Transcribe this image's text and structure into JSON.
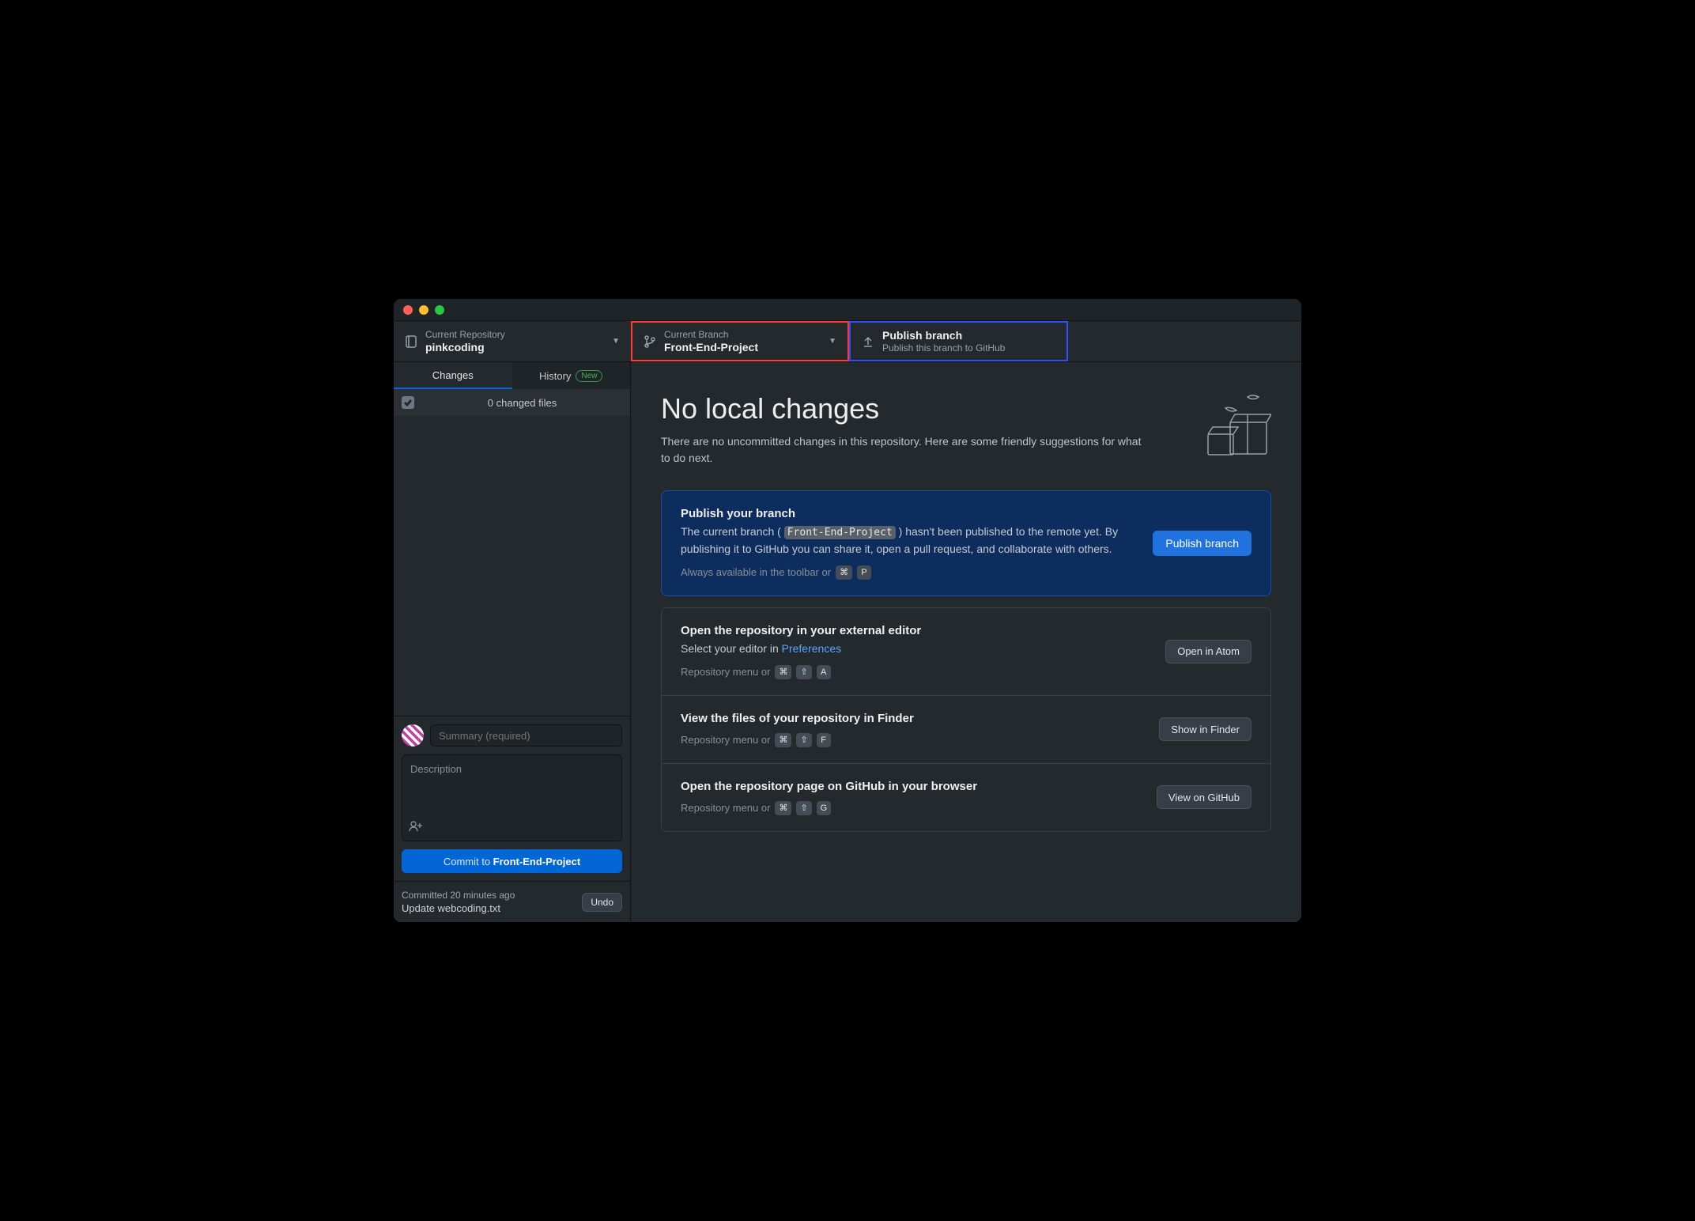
{
  "toolbar": {
    "repo": {
      "label": "Current Repository",
      "value": "pinkcoding"
    },
    "branch": {
      "label": "Current Branch",
      "value": "Front-End-Project"
    },
    "publish": {
      "title": "Publish branch",
      "subtitle": "Publish this branch to GitHub"
    }
  },
  "sidebar": {
    "tabs": {
      "changes": "Changes",
      "history": "History",
      "new_badge": "New"
    },
    "files_count": "0 changed files",
    "commit_form": {
      "summary_placeholder": "Summary (required)",
      "description_placeholder": "Description",
      "commit_prefix": "Commit to ",
      "commit_branch": "Front-End-Project"
    },
    "last_commit": {
      "time": "Committed 20 minutes ago",
      "message": "Update webcoding.txt",
      "undo": "Undo"
    }
  },
  "main": {
    "heading": "No local changes",
    "subtitle": "There are no uncommitted changes in this repository. Here are some friendly suggestions for what to do next.",
    "cards": {
      "publish": {
        "title": "Publish your branch",
        "text_before": "The current branch ( ",
        "code": "Front-End-Project",
        "text_after": " ) hasn't been published to the remote yet. By publishing it to GitHub you can share it, open a pull request, and collaborate with others.",
        "hint": "Always available in the toolbar or",
        "keys": [
          "⌘",
          "P"
        ],
        "button": "Publish branch"
      },
      "editor": {
        "title": "Open the repository in your external editor",
        "text": "Select your editor in ",
        "link": "Preferences",
        "hint": "Repository menu or",
        "keys": [
          "⌘",
          "⇧",
          "A"
        ],
        "button": "Open in Atom"
      },
      "finder": {
        "title": "View the files of your repository in Finder",
        "hint": "Repository menu or",
        "keys": [
          "⌘",
          "⇧",
          "F"
        ],
        "button": "Show in Finder"
      },
      "github": {
        "title": "Open the repository page on GitHub in your browser",
        "hint": "Repository menu or",
        "keys": [
          "⌘",
          "⇧",
          "G"
        ],
        "button": "View on GitHub"
      }
    }
  }
}
